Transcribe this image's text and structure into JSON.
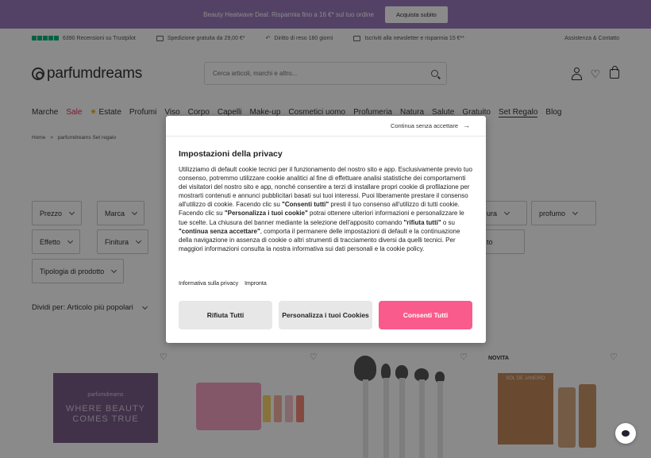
{
  "banner": {
    "text": "Beauty Heatwave Deal: Risparmia fino a 16 €* sul tuo ordine",
    "button": "Acquista subito"
  },
  "infobar": {
    "reviews": "6390 Recensioni su Trustpilot",
    "shipping": "Spedizione gratuita da 29,00 €*",
    "returns": "Diritto di reso 180 giorni",
    "newsletter": "Iscriviti alla newsletter e risparmia 15 €**",
    "support": "Assistenza & Contatto"
  },
  "header": {
    "logo": "parfumdreams",
    "search_placeholder": "Cerca articoli, marchi e altro..."
  },
  "nav": [
    "Marche",
    "Sale",
    "Estate",
    "Profumi",
    "Viso",
    "Corpo",
    "Capelli",
    "Make-up",
    "Cosmetici uomo",
    "Profumeria",
    "Natura",
    "Salute",
    "Gratuito",
    "Set Regalo",
    "Blog"
  ],
  "breadcrumb": {
    "home": "Home",
    "sep": ">",
    "current": "parfumdreams Set regalo"
  },
  "filters": {
    "prezzo": "Prezzo",
    "marca": "Marca",
    "effetto": "Effetto",
    "finitura": "Finitura",
    "tipologia": "Tipologia di prodotto",
    "profumo": "profumo",
    "partial1": "ura",
    "partial2": "to"
  },
  "sort": {
    "label": "Dividi per: Articolo più popolari"
  },
  "products": {
    "badge": "NOVITA",
    "promo_mini": "parfumdreams",
    "promo_big": "WHERE BEAUTY COMES TRUE",
    "brand4": "SOL DE JANEIRO"
  },
  "modal": {
    "continue": "Continua senza accettare",
    "title": "Impostazioni della privacy",
    "body_html": "Utilizziamo di default cookie tecnici per il funzionamento del nostro sito e app. Esclusivamente previo tuo consenso, potremmo utilizzare cookie analitici al fine di effettuare analisi statistiche dei comportamenti dei visitatori del nostro sito e app, nonché consentire a terzi di installare propri cookie di profilazione per mostrarti contenuti e annunci pubblicitari basati sui tuoi interessi. Puoi liberamente prestare il consenso all'utilizzo di cookie. Facendo clic su <b>\"Consenti tutti\"</b> presti il tuo consenso all'utilizzo di tutti cookie. Facendo clic su <b>\"Personalizza i tuoi cookie\"</b> potrai ottenere ulteriori informazioni e personalizzare le tue scelte. La chiusura del banner mediante la selezione dell'apposito comando <b>\"rifiuta tutti\"</b> o su <b>\"continua senza accettare\"</b>, comporta il permanere delle impostazioni di default e la continuazione della navigazione in assenza di cookie o altri strumenti di tracciamento diversi da quelli tecnici. Per maggiori informazioni consulta la nostra informativa sui dati personali e la cookie policy.",
    "link_privacy": "Informativa sulla privacy",
    "link_imprint": "Impronta",
    "btn_reject": "Rifiuta Tutti",
    "btn_customize": "Personalizza i tuoi Cookies",
    "btn_accept": "Consenti Tutti"
  },
  "colors": {
    "banner": "#9b7bbd",
    "accent": "#f95b8c",
    "sale": "#e0305a",
    "trustpilot": "#00b67a"
  },
  "icons": [
    "star-icon",
    "truck-icon",
    "return-icon",
    "mail-icon",
    "search-icon",
    "user-icon",
    "heart-icon",
    "bag-icon",
    "chat-icon",
    "arrow-right-icon",
    "chevron-down-icon"
  ]
}
